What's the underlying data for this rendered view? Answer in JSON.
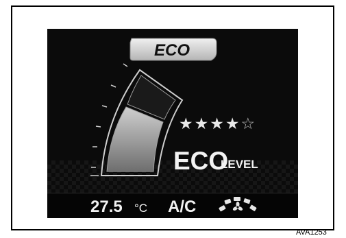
{
  "display": {
    "mode_label": "ECO",
    "rating": {
      "filled": 4,
      "total": 5
    },
    "eco_word": "ECO",
    "level_word": "LEVEL",
    "gauge_level": 0.8
  },
  "climate": {
    "temperature": "27.5",
    "unit": "°C",
    "ac_label": "A/C"
  },
  "icons": {
    "fan": "fan-speed-icon"
  },
  "figure": {
    "code": "AVA1253"
  },
  "colors": {
    "screen_bg": "#0b0b0b",
    "text": "#f2f2f2",
    "tab": "#d7d7d7"
  }
}
